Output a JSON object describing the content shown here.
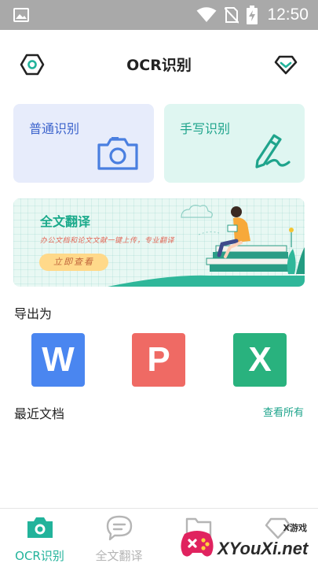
{
  "status_bar": {
    "time": "12:50",
    "icons": [
      "image-icon",
      "wifi-icon",
      "no-sim-icon",
      "battery-charging-icon"
    ]
  },
  "header": {
    "title": "OCR识别",
    "left_icon": "settings-hex-icon",
    "right_icon": "vip-diamond-icon"
  },
  "cards": {
    "normal": {
      "label": "普通识别",
      "icon": "camera-icon"
    },
    "handwriting": {
      "label": "手写识别",
      "icon": "pen-icon"
    }
  },
  "banner": {
    "title": "全文翻译",
    "subtitle": "办公文档和论文文献一键上传，专业翻译",
    "button": "立即查看"
  },
  "export": {
    "title": "导出为",
    "formats": [
      {
        "letter": "W",
        "color": "#4a86f0"
      },
      {
        "letter": "P",
        "color": "#ef6a64"
      },
      {
        "letter": "X",
        "color": "#29b27e"
      }
    ]
  },
  "recent": {
    "title": "最近文档",
    "view_all": "查看所有"
  },
  "tabs": [
    {
      "label": "OCR识别",
      "icon": "camera-tab-icon",
      "active": true
    },
    {
      "label": "全文翻译",
      "icon": "chat-bubble-icon",
      "active": false
    },
    {
      "label": "",
      "icon": "folder-icon",
      "active": false
    },
    {
      "label": "",
      "icon": "vip-icon",
      "active": false
    }
  ],
  "watermark": {
    "brand": "XYouXi.net",
    "small": "X游戏"
  },
  "colors": {
    "accent": "#22b39b",
    "status_bar": "#a9a9a9"
  }
}
